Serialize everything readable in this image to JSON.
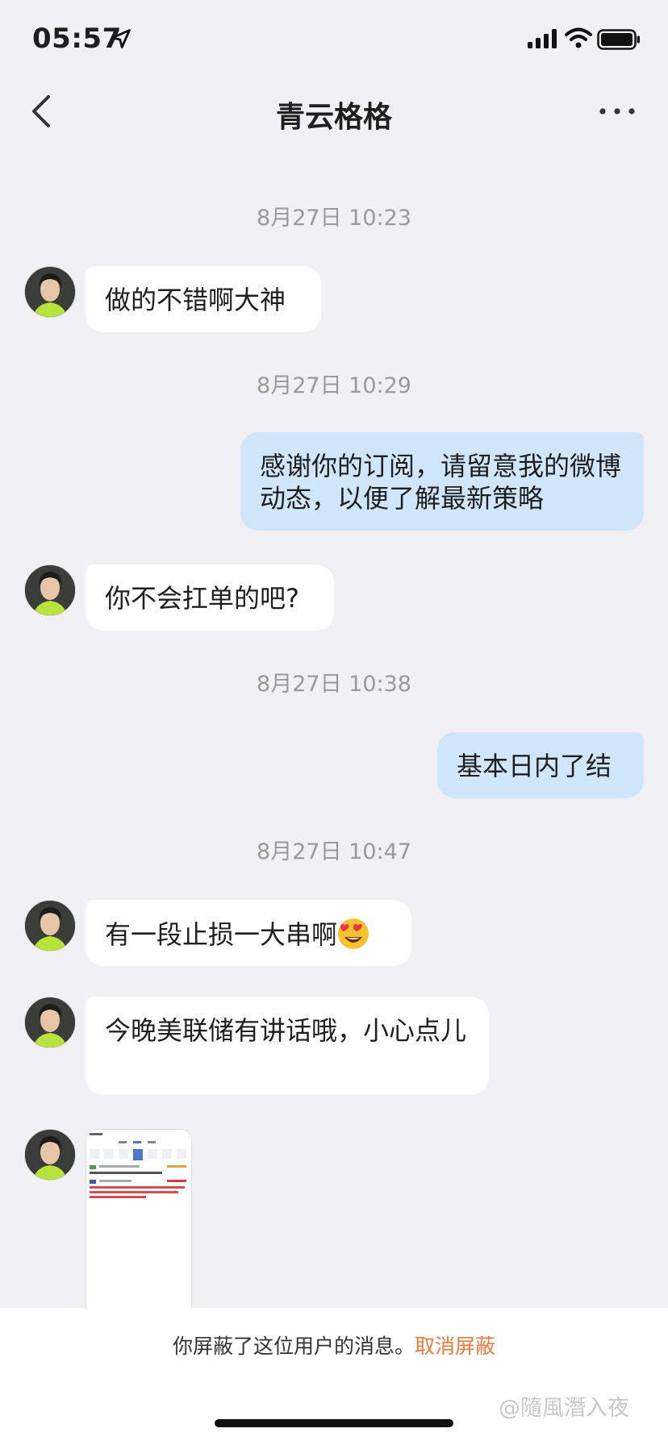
{
  "status_bar": {
    "time": "05:57"
  },
  "header": {
    "title": "青云格格"
  },
  "messages": [
    {
      "timestamp": "8月27日 10:23"
    },
    {
      "text": "做的不错啊大神"
    },
    {
      "timestamp": "8月27日 10:29"
    },
    {
      "text": "感谢你的订阅，请留意我的微博动态，以便了解最新策略"
    },
    {
      "text": "你不会扛单的吧?"
    },
    {
      "timestamp": "8月27日 10:38"
    },
    {
      "text": "基本日内了结"
    },
    {
      "timestamp": "8月27日 10:47"
    },
    {
      "text": "有一段止损一大串啊"
    },
    {
      "text": "今晚美联储有讲话哦，小心点儿"
    }
  ],
  "footer": {
    "blocked_text": "你屏蔽了这位用户的消息。",
    "unblock_label": "取消屏蔽",
    "watermark": "@隨風潛入夜"
  },
  "colors": {
    "accent": "#ec7a3c",
    "outgoing_bubble": "#cfe6fb",
    "incoming_bubble": "#ffffff",
    "background": "#f1f0f2"
  },
  "icons": [
    "location-arrow-icon",
    "signal-icon",
    "wifi-icon",
    "battery-icon",
    "back-icon",
    "more-icon",
    "heart-eyes-emoji-icon"
  ]
}
